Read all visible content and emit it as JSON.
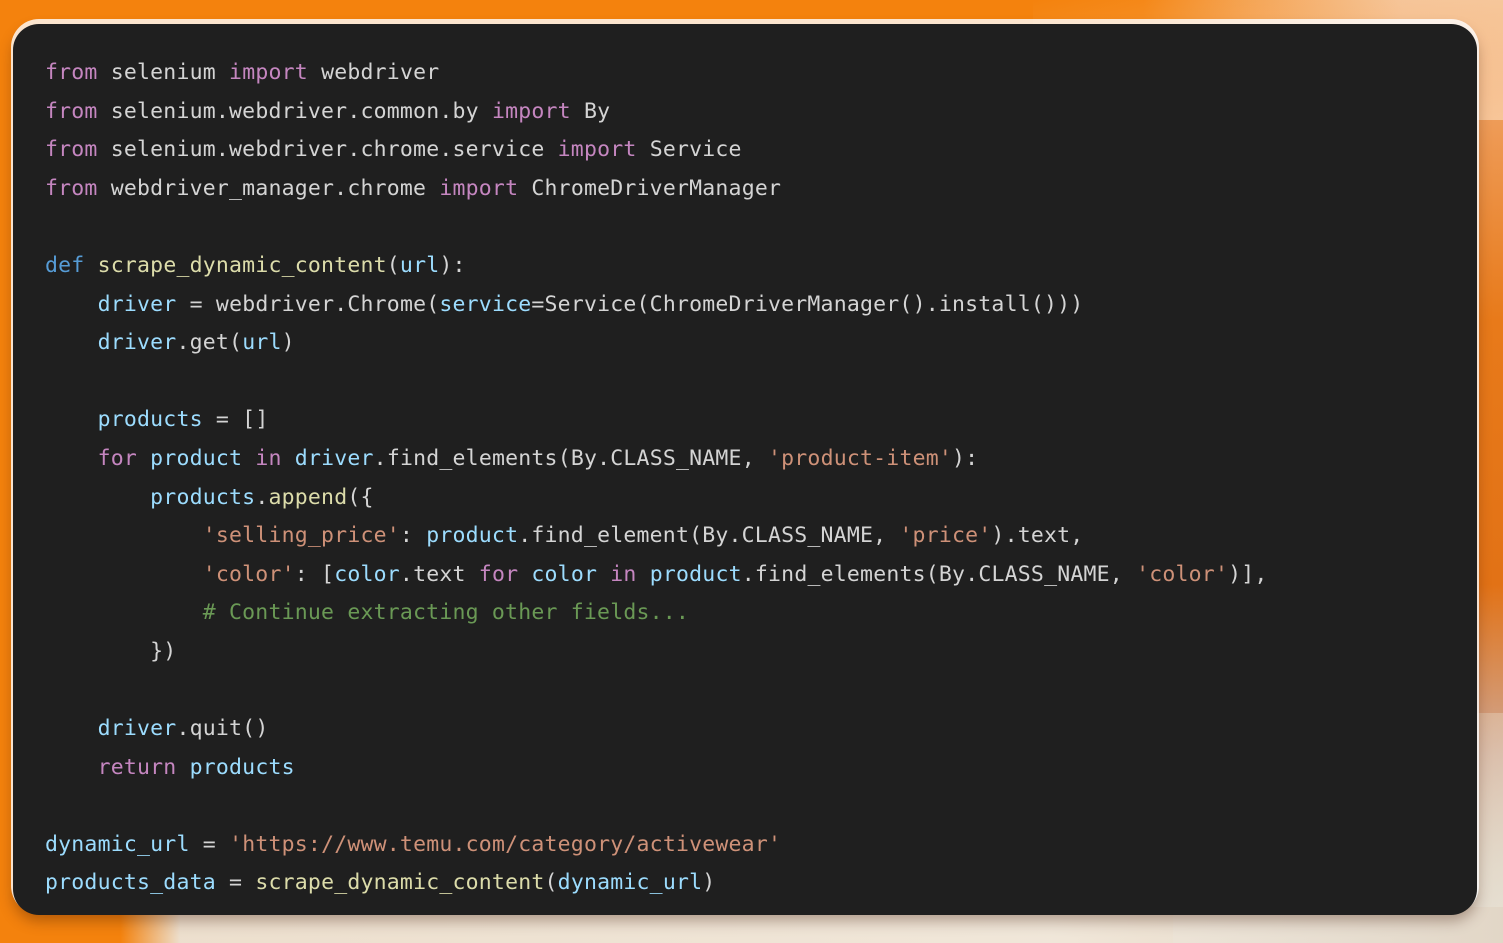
{
  "background": {
    "primary_color": "#F4820D",
    "accent_light": "#F3BE8F",
    "accent_bottom": "#E2D8CC"
  },
  "code_block": {
    "background_color": "#1F1F1F",
    "language": "python",
    "theme_colors": {
      "keyword": "#C586C0",
      "declaration": "#569CD6",
      "function": "#DCDCAA",
      "variable": "#9CDCFE",
      "string": "#CE9178",
      "comment": "#6A9955",
      "plain": "#D4D4D4"
    },
    "lines": [
      {
        "n": 1,
        "text": "from selenium import webdriver"
      },
      {
        "n": 2,
        "text": "from selenium.webdriver.common.by import By"
      },
      {
        "n": 3,
        "text": "from selenium.webdriver.chrome.service import Service"
      },
      {
        "n": 4,
        "text": "from webdriver_manager.chrome import ChromeDriverManager"
      },
      {
        "n": 5,
        "text": ""
      },
      {
        "n": 6,
        "text": "def scrape_dynamic_content(url):"
      },
      {
        "n": 7,
        "text": "    driver = webdriver.Chrome(service=Service(ChromeDriverManager().install()))"
      },
      {
        "n": 8,
        "text": "    driver.get(url)"
      },
      {
        "n": 9,
        "text": ""
      },
      {
        "n": 10,
        "text": "    products = []"
      },
      {
        "n": 11,
        "text": "    for product in driver.find_elements(By.CLASS_NAME, 'product-item'):"
      },
      {
        "n": 12,
        "text": "        products.append({"
      },
      {
        "n": 13,
        "text": "            'selling_price': product.find_element(By.CLASS_NAME, 'price').text,"
      },
      {
        "n": 14,
        "text": "            'color': [color.text for color in product.find_elements(By.CLASS_NAME, 'color')],"
      },
      {
        "n": 15,
        "text": "            # Continue extracting other fields..."
      },
      {
        "n": 16,
        "text": "        })"
      },
      {
        "n": 17,
        "text": ""
      },
      {
        "n": 18,
        "text": "    driver.quit()"
      },
      {
        "n": 19,
        "text": "    return products"
      },
      {
        "n": 20,
        "text": ""
      },
      {
        "n": 21,
        "text": "dynamic_url = 'https://www.temu.com/category/activewear'"
      },
      {
        "n": 22,
        "text": "products_data = scrape_dynamic_content(dynamic_url)"
      }
    ],
    "symbols": {
      "imports": [
        "webdriver",
        "By",
        "Service",
        "ChromeDriverManager"
      ],
      "modules": [
        "selenium",
        "selenium.webdriver.common.by",
        "selenium.webdriver.chrome.service",
        "webdriver_manager.chrome"
      ],
      "function_name": "scrape_dynamic_content",
      "parameter": "url",
      "variables": [
        "driver",
        "products",
        "product",
        "color",
        "dynamic_url",
        "products_data"
      ],
      "strings": [
        "product-item",
        "selling_price",
        "price",
        "color",
        "https://www.temu.com/category/activewear"
      ],
      "comment": "# Continue extracting other fields...",
      "keywords": [
        "from",
        "import",
        "def",
        "for",
        "in",
        "return"
      ],
      "dict_keys": [
        "selling_price",
        "color"
      ],
      "selector_constant": "By.CLASS_NAME",
      "methods": [
        "webdriver.Chrome",
        "driver.get",
        "driver.find_elements",
        "products.append",
        "product.find_element",
        "product.find_elements",
        "driver.quit",
        "ChromeDriverManager().install"
      ],
      "target_url": "https://www.temu.com/category/activewear"
    }
  }
}
